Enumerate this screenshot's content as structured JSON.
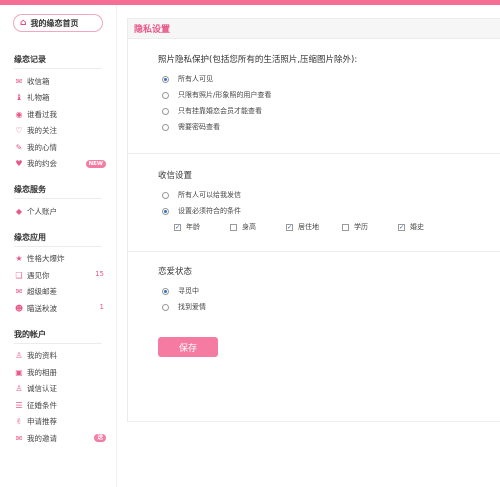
{
  "sidebar": {
    "home": "我的缘恋首页",
    "sections": [
      {
        "title": "缘恋记录",
        "items": [
          {
            "label": "收信箱",
            "icon": "mail-icon",
            "glyph": "✉"
          },
          {
            "label": "礼物箱",
            "icon": "gift-icon",
            "glyph": "♝"
          },
          {
            "label": "谁看过我",
            "icon": "eye-icon",
            "glyph": "◉"
          },
          {
            "label": "我的关注",
            "icon": "heart-icon",
            "glyph": "♡"
          },
          {
            "label": "我的心情",
            "icon": "note-icon",
            "glyph": "✎"
          },
          {
            "label": "我的约会",
            "icon": "couple-icon",
            "glyph": "♥",
            "badge": "NEW"
          }
        ]
      },
      {
        "title": "缘恋服务",
        "items": [
          {
            "label": "个人账户",
            "icon": "tag-icon",
            "glyph": "◆"
          }
        ]
      },
      {
        "title": "缘恋应用",
        "items": [
          {
            "label": "性格大爆炸",
            "icon": "star-icon",
            "glyph": "★"
          },
          {
            "label": "遇见你",
            "icon": "cards-icon",
            "glyph": "❑",
            "count": "15"
          },
          {
            "label": "超级邮差",
            "icon": "postman-icon",
            "glyph": "✉"
          },
          {
            "label": "瞄送秋波",
            "icon": "wink-icon",
            "glyph": "☻",
            "count": "1"
          }
        ]
      },
      {
        "title": "我的帐户",
        "items": [
          {
            "label": "我的资料",
            "icon": "user-icon",
            "glyph": "♙"
          },
          {
            "label": "我的相册",
            "icon": "album-icon",
            "glyph": "▣"
          },
          {
            "label": "诚信认证",
            "icon": "verify-icon",
            "glyph": "♙"
          },
          {
            "label": "征婚条件",
            "icon": "list-icon",
            "glyph": "☰"
          },
          {
            "label": "申请推荐",
            "icon": "thumb-up-icon",
            "glyph": "✌"
          },
          {
            "label": "我的邀请",
            "icon": "invite-icon",
            "glyph": "✉",
            "badge": "送"
          }
        ]
      }
    ]
  },
  "main": {
    "header": "隐私设置",
    "photo": {
      "title": "照片隐私保护(包括您所有的生活照片,压缩图片除外):",
      "options": [
        "所有人可见",
        "只限有照片/形象照的用户查看",
        "只有挂靠婚恋会员才能查看",
        "需要密码查看"
      ],
      "selected": 0
    },
    "mail": {
      "title": "收信设置",
      "options": [
        "所有人可以给我发信",
        "设置必须符合的条件"
      ],
      "selected": 1,
      "conditions": [
        {
          "label": "年龄",
          "checked": true
        },
        {
          "label": "身高",
          "checked": false
        },
        {
          "label": "居住地",
          "checked": true
        },
        {
          "label": "学历",
          "checked": false
        },
        {
          "label": "婚史",
          "checked": true
        }
      ]
    },
    "love": {
      "title": "恋爱状态",
      "options": [
        "寻觅中",
        "找到爱情"
      ],
      "selected": 0
    },
    "save_label": "保存"
  },
  "colors": {
    "accent": "#f57ba3",
    "brand": "#f46e96",
    "title": "#e8588a"
  }
}
